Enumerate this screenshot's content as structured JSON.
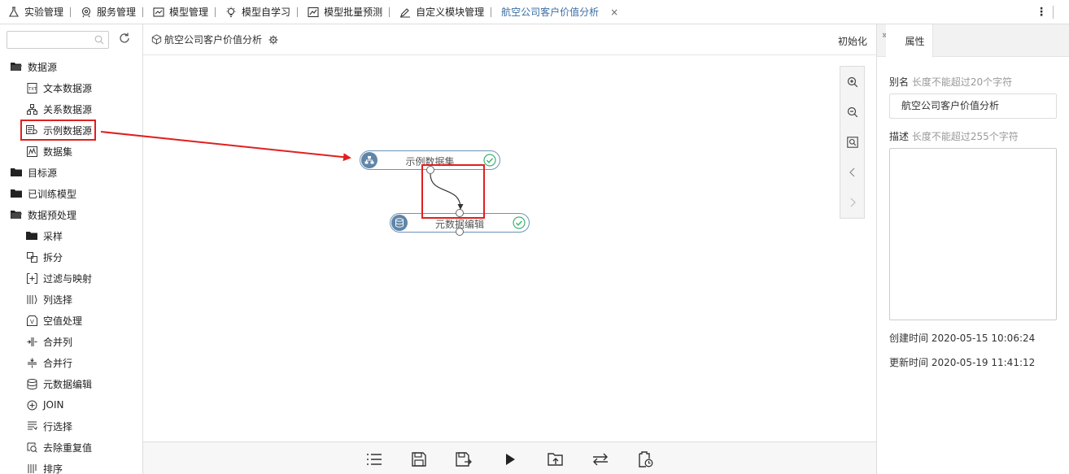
{
  "tabs": [
    {
      "label": "实验管理",
      "icon": "flask-icon"
    },
    {
      "label": "服务管理",
      "icon": "service-icon"
    },
    {
      "label": "模型管理",
      "icon": "model-chart-icon"
    },
    {
      "label": "模型自学习",
      "icon": "bulb-icon"
    },
    {
      "label": "模型批量预测",
      "icon": "line-chart-icon"
    },
    {
      "label": "自定义模块管理",
      "icon": "edit-icon"
    },
    {
      "label": "航空公司客户价值分析",
      "icon": "",
      "active": true,
      "close": "×"
    }
  ],
  "top_menu": {
    "more": "⋮"
  },
  "left": {
    "search_placeholder": "",
    "tree": {
      "datasource": "数据源",
      "text_ds": "文本数据源",
      "rel_ds": "关系数据源",
      "sample_ds": "示例数据源",
      "dataset": "数据集",
      "target": "目标源",
      "trained": "已训练模型",
      "preprocess": "数据预处理",
      "sampling": "采样",
      "split": "拆分",
      "filter_map": "过滤与映射",
      "col_select": "列选择",
      "null_handle": "空值处理",
      "merge_col": "合并列",
      "merge_row": "合并行",
      "meta_edit": "元数据编辑",
      "join": "JOIN",
      "row_select": "行选择",
      "dedup": "去除重复值",
      "sort": "排序"
    }
  },
  "canvas": {
    "title": "航空公司客户价值分析",
    "init_label": "初始化",
    "nodes": {
      "sample_dataset": "示例数据集",
      "meta_edit": "元数据编辑"
    }
  },
  "properties": {
    "tab_label": "属性",
    "collapse": "»",
    "alias_label": "别名",
    "alias_hint": "长度不能超过20个字符",
    "alias_value": "航空公司客户价值分析",
    "desc_label": "描述",
    "desc_hint": "长度不能超过255个字符",
    "desc_value": "",
    "created": "创建时间 2020-05-15 10:06:24",
    "updated": "更新时间 2020-05-19 11:41:12"
  },
  "colors": {
    "accent": "#3a6ea5",
    "node_border": "#6c93b5",
    "node_icon": "#5f86a8",
    "highlight": "#e02020",
    "check": "#3cb371"
  }
}
